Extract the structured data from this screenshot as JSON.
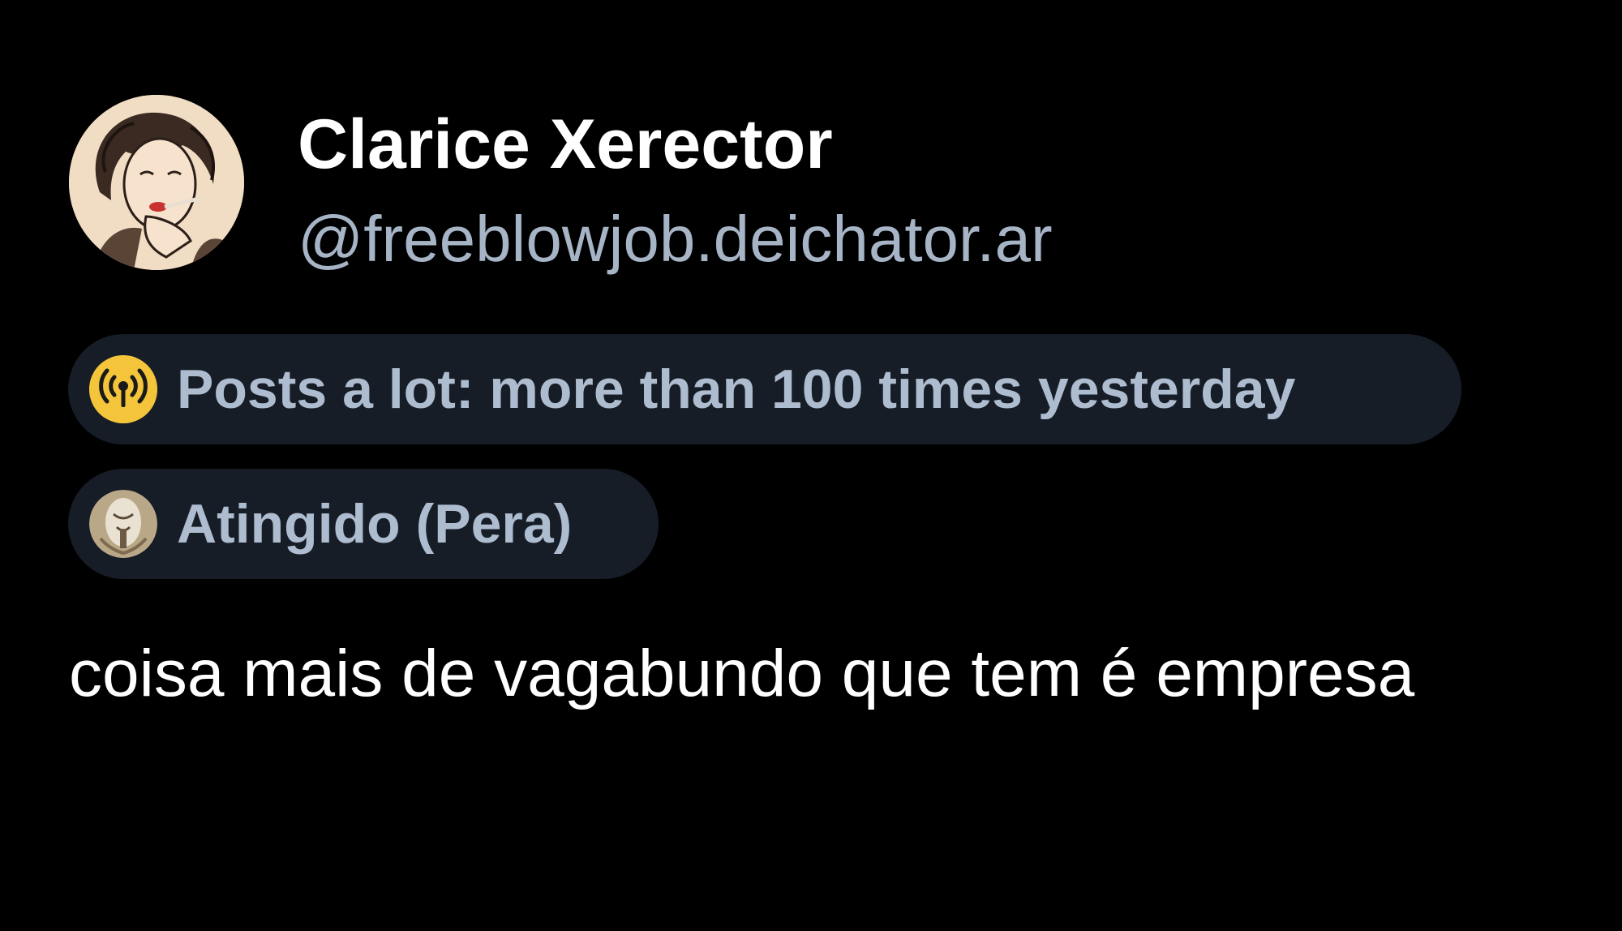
{
  "colors": {
    "background": "#000000",
    "name": "#ffffff",
    "handle": "#a6b4c6",
    "badge_bg": "#161d27",
    "badge_text": "#aebccf",
    "activity_icon_bg": "#f4c53b",
    "post_text": "#ffffff"
  },
  "author": {
    "display_name": "Clarice Xerector",
    "handle": "@freeblowjob.deichator.ar",
    "avatar_icon": "avatar-portrait-illustration"
  },
  "badges": [
    {
      "icon": "broadcast-signal-icon",
      "text": "Posts a lot: more than 100 times yesterday"
    },
    {
      "icon": "label-image-icon",
      "text": "Atingido (Pera)"
    }
  ],
  "post": {
    "text": "coisa mais de vagabundo que tem é empresa"
  }
}
